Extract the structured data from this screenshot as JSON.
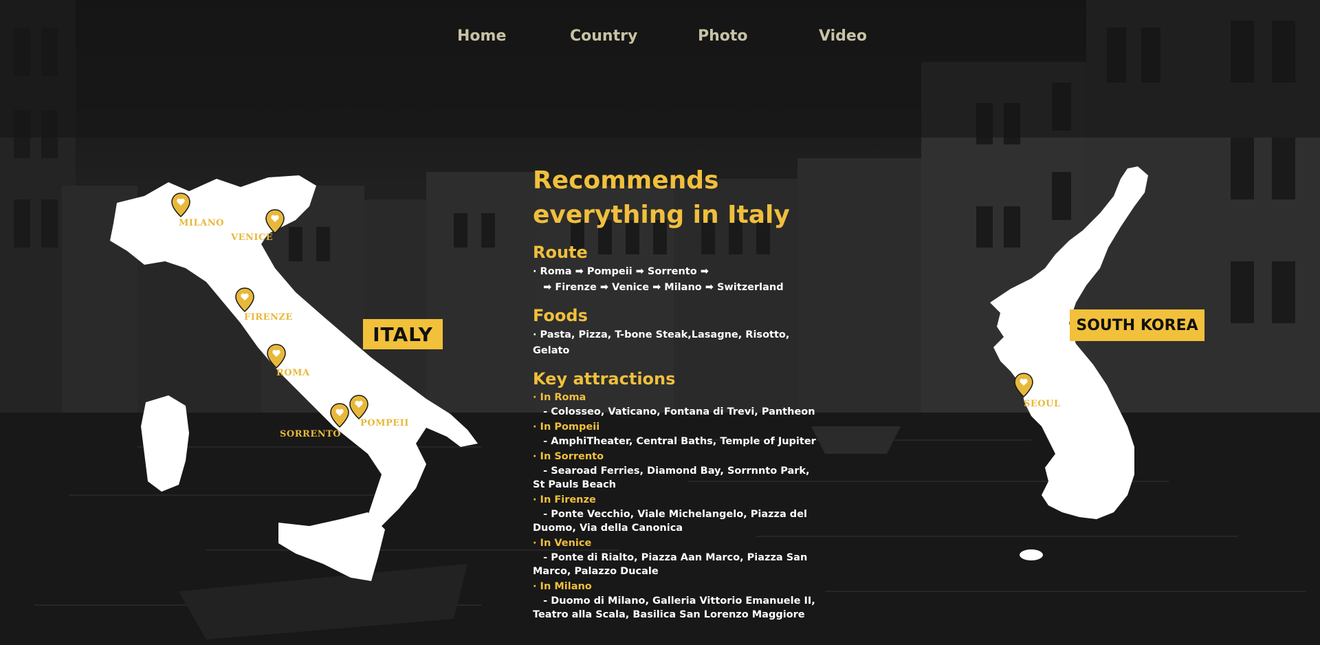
{
  "nav": {
    "items": [
      "Home",
      "Country",
      "Photo",
      "Video"
    ]
  },
  "italy_map": {
    "badge": "ITALY",
    "cities": [
      "MILANO",
      "VENICE",
      "FIRENZE",
      "ROMA",
      "SORRENTO",
      "POMPEII"
    ]
  },
  "korea_map": {
    "badge": "SOUTH KOREA",
    "cities": [
      "SEOUL"
    ]
  },
  "content": {
    "headline_1": "Recommends",
    "headline_2": "everything in Italy",
    "route_title": "Route",
    "route_line_1": "· Roma ➡ Pompeii ➡ Sorrento ➡",
    "route_line_2": "   ➡ Firenze ➡ Venice ➡ Milano ➡ Switzerland",
    "foods_title": "Foods",
    "foods_line": "· Pasta, Pizza, T-bone Steak,Lasagne, Risotto, Gelato",
    "attractions_title": "Key attractions",
    "attractions": [
      {
        "city": " · In Roma",
        "desc": "   - Colosseo, Vaticano, Fontana di Trevi, Pantheon"
      },
      {
        "city": " · In Pompeii",
        "desc": "   - AmphiTheater, Central Baths, Temple of Jupiter"
      },
      {
        "city": " · In Sorrento",
        "desc": "   - Searoad Ferries, Diamond Bay, Sorrnnto Park, St Pauls Beach"
      },
      {
        "city": " · In Firenze",
        "desc": "   - Ponte Vecchio, Viale Michelangelo, Piazza del Duomo, Via della Canonica"
      },
      {
        "city": " · In Venice",
        "desc": "   - Ponte di Rialto, Piazza Aan Marco, Piazza San Marco, Palazzo Ducale"
      },
      {
        "city": " · In Milano",
        "desc": "   - Duomo di Milano, Galleria Vittorio Emanuele II, Teatro alla Scala, Basilica San Lorenzo Maggiore"
      }
    ]
  },
  "colors": {
    "accent": "#f0bf3c",
    "nav_text": "#c8c2a5",
    "map_fill": "#ffffff",
    "background": "#1c1c1c"
  }
}
